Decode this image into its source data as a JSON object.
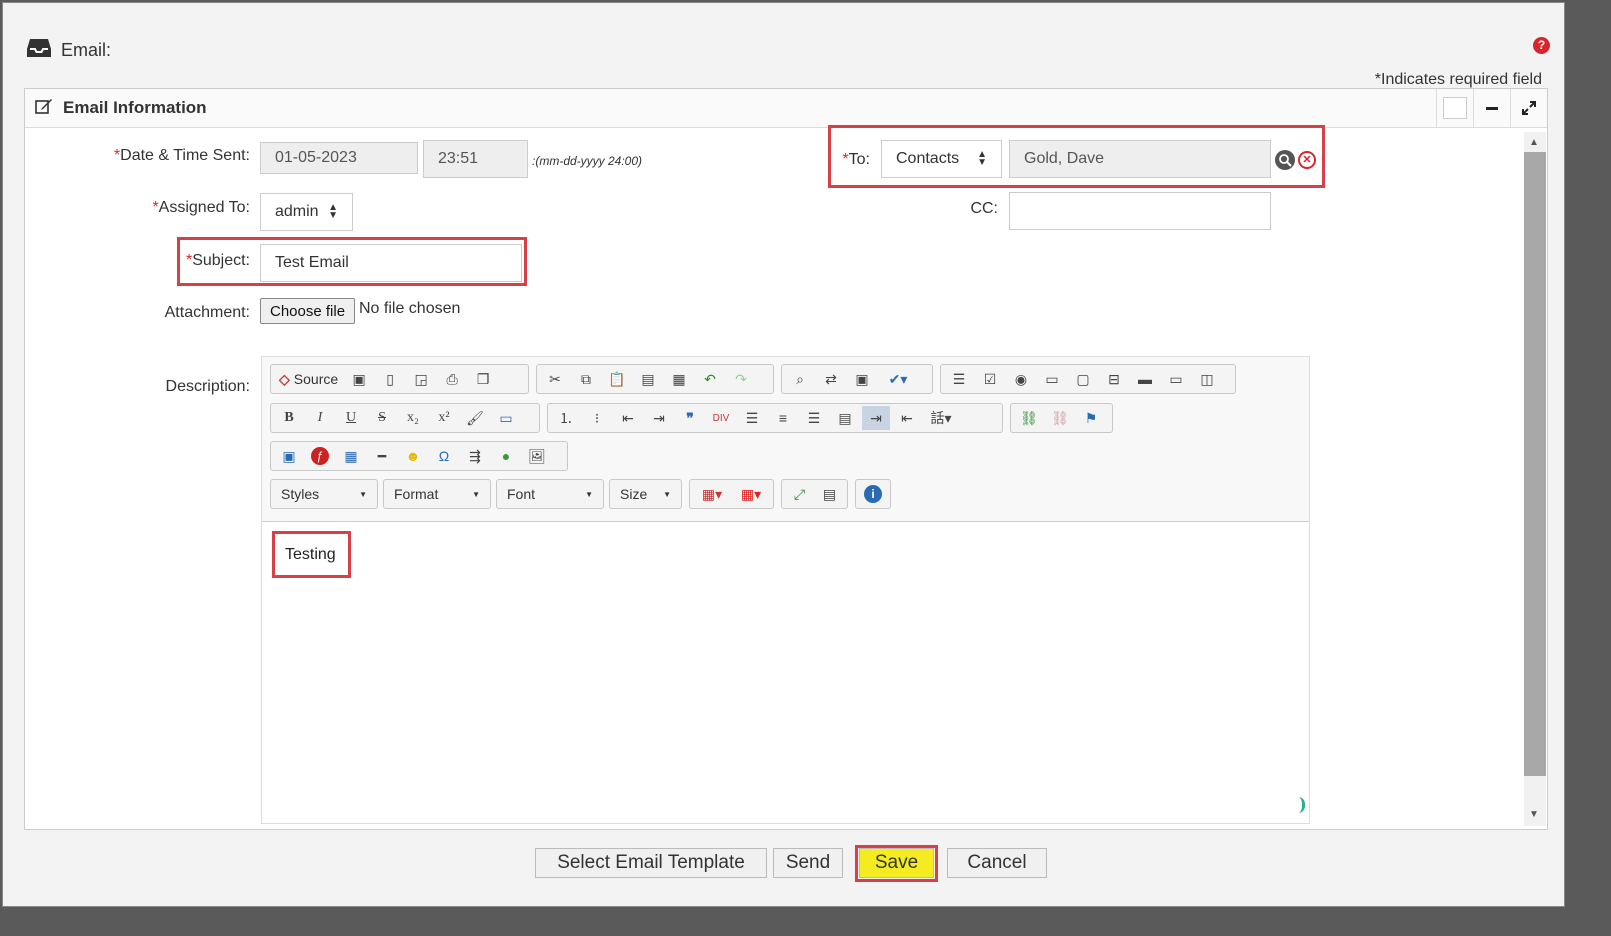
{
  "header": {
    "title": "Email:",
    "required_note": "*Indicates required field"
  },
  "panel": {
    "title": "Email Information"
  },
  "form": {
    "date_label": "Date & Time Sent:",
    "date_value": "01-05-2023",
    "time_value": "23:51",
    "date_format_hint": ":(mm-dd-yyyy 24:00)",
    "assigned_label": "Assigned To:",
    "assigned_value": "admin",
    "subject_label": "Subject:",
    "subject_value": "Test Email",
    "attachment_label": "Attachment:",
    "choose_file_label": "Choose file",
    "no_file_text": "No file chosen",
    "description_label": "Description:",
    "to_label": "To:",
    "to_type_value": "Contacts",
    "to_value": "Gold, Dave",
    "cc_label": "CC:",
    "cc_value": "",
    "required_mark": "*"
  },
  "editor": {
    "source_label": "Source",
    "styles_label": "Styles",
    "format_label": "Format",
    "font_label": "Font",
    "size_label": "Size",
    "body_text": "Testing"
  },
  "footer": {
    "select_template_label": "Select Email Template",
    "send_label": "Send",
    "save_label": "Save",
    "cancel_label": "Cancel"
  },
  "colors": {
    "highlight": "#d84048",
    "save_bg": "#f4ec20",
    "required": "#d9262c"
  }
}
